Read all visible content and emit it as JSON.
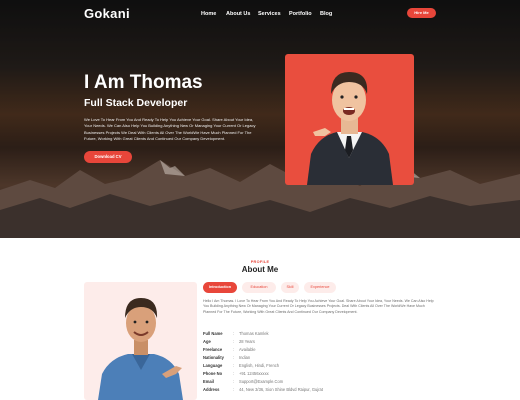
{
  "brand": {
    "logo": "Gokani",
    "accent": "#e8463a"
  },
  "nav": {
    "links": [
      "Home",
      "About Us",
      "Services",
      "Portfolio",
      "Blog"
    ],
    "hire_button": "Hire Me"
  },
  "hero": {
    "title": "I Am Thomas",
    "subtitle": "Full Stack Developer",
    "description": "We Love To Hear From You And Ready To Help You Achieve Your Goal. Share About Your Idea, Your Needs. We Can Also Help You Building Anything New Or Managing Your Current Or Legacy Businesses Projects We Deal With Clients All Over The WorldWe Have Much Planned For The Future, Working With Great Clients And Continued Our Company Development.",
    "download_button": "Download CV"
  },
  "about": {
    "label": "PROFILE",
    "title": "About Me",
    "tabs": [
      "Introduction",
      "Education",
      "Skill",
      "Experience"
    ],
    "intro": "Hello I Am Thomas. I Love To Hear From You And Ready To Help You Achieve Your Goal. Share About Your Idea, Your Needs. We Can Also Help You Building Anything New Or Managing Your Current Or Legacy Businesses Projects. Deal With Clients All Over The WorldWe Have Much Planned For The Future, Working With Great Clients And Continued Our Company Development.",
    "info": [
      {
        "key": "Full Name",
        "value": "Thomas Kamlek"
      },
      {
        "key": "Age",
        "value": "28 Years"
      },
      {
        "key": "Freelance",
        "value": "Available"
      },
      {
        "key": "Nationality",
        "value": "Indian"
      },
      {
        "key": "Language",
        "value": "English, Hindi, French"
      },
      {
        "key": "Phone No",
        "value": "+91 12456xxxxx"
      },
      {
        "key": "Email",
        "value": "Support@Example.Com"
      },
      {
        "key": "Address",
        "value": "44, New 3/36, Sion Shine Bldvd Raipur, Gujrat"
      }
    ]
  }
}
